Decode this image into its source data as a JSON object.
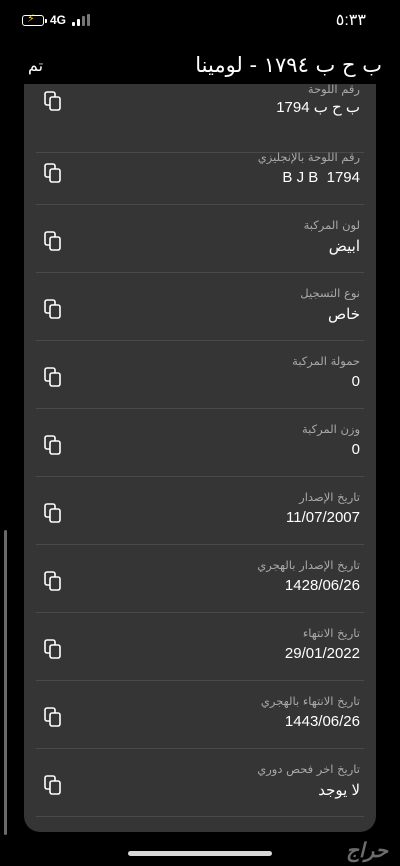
{
  "status": {
    "time": "٥:٣٣",
    "network": "4G"
  },
  "nav": {
    "done_label": "تم",
    "title": "ب ح ب ١٧٩٤ - لومينا"
  },
  "fields": [
    {
      "label": "رقم اللوحة",
      "value": "ب ح ب 1794"
    },
    {
      "label": "رقم اللوحة بالإنجليزي",
      "value": "1794  B J B"
    },
    {
      "label": "لون المركبة",
      "value": "ابيض"
    },
    {
      "label": "نوع التسجيل",
      "value": "خاص"
    },
    {
      "label": "حمولة المركبة",
      "value": "0"
    },
    {
      "label": "وزن المركبة",
      "value": "0"
    },
    {
      "label": "تاريخ الإصدار",
      "value": "11/07/2007"
    },
    {
      "label": "تاريخ الإصدار بالهجري",
      "value": "1428/06/26"
    },
    {
      "label": "تاريخ الانتهاء",
      "value": "29/01/2022"
    },
    {
      "label": "تاريخ الانتهاء بالهجري",
      "value": "1443/06/26"
    },
    {
      "label": "تاريخ اخر فحص دوري",
      "value": "لا يوجد"
    }
  ],
  "watermark": "حراج",
  "icons": {
    "copy": "copy-icon",
    "battery": "battery-charging-icon",
    "signal": "signal-icon"
  }
}
